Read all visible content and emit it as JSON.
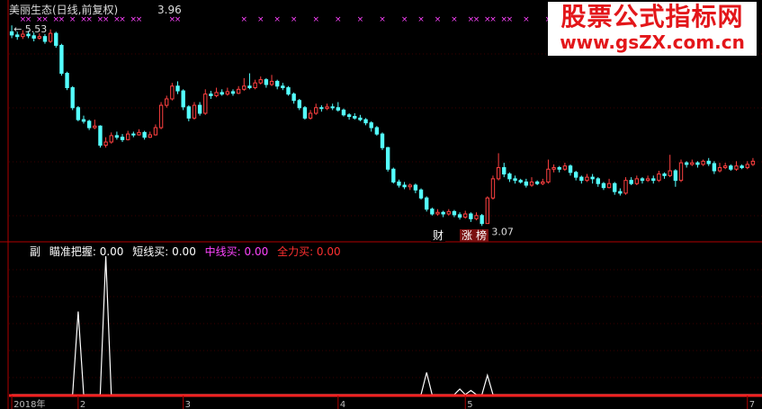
{
  "header": {
    "title": "美丽生态(日线,前复权)",
    "price": "3.96"
  },
  "indicator_header": {
    "prefix": "副",
    "items": [
      {
        "label": "瞄准把握: 0.00",
        "color": "#ffffff"
      },
      {
        "label": "短线买: 0.00",
        "color": "#ffffff"
      },
      {
        "label": "中线买: 0.00",
        "color": "#ff44ff"
      },
      {
        "label": "全力买: 0.00",
        "color": "#ff3030"
      }
    ]
  },
  "watermark": {
    "title": "股票公式指标网",
    "url": "www.gsZX.com.cn"
  },
  "badges": {
    "cai": "财",
    "zhangting": "涨",
    "bang": "榜"
  },
  "colors": {
    "up": "#ff4040",
    "down": "#54ffff",
    "axis": "#b00000",
    "magenta": "#ff44ff",
    "baseline": "#ff2020"
  },
  "chart_data": [
    {
      "type": "candlestick",
      "title": "美丽生态(日线,前复权)",
      "annotations": [
        {
          "text": "5.53",
          "kind": "high-marker"
        },
        {
          "text": "3.07",
          "kind": "low-marker"
        }
      ],
      "ylim": [
        2.95,
        5.65
      ],
      "candles": [
        [
          5.5,
          5.46,
          5.58,
          5.42
        ],
        [
          5.46,
          5.44,
          5.5,
          5.4
        ],
        [
          5.44,
          5.47,
          5.52,
          5.41
        ],
        [
          5.47,
          5.45,
          5.51,
          5.42
        ],
        [
          5.45,
          5.42,
          5.49,
          5.38
        ],
        [
          5.42,
          5.44,
          5.48,
          5.4
        ],
        [
          5.44,
          5.38,
          5.47,
          5.35
        ],
        [
          5.38,
          5.48,
          5.53,
          5.36
        ],
        [
          5.48,
          5.33,
          5.5,
          5.3
        ],
        [
          5.33,
          4.98,
          5.35,
          4.95
        ],
        [
          4.98,
          4.8,
          5.0,
          4.77
        ],
        [
          4.8,
          4.55,
          4.82,
          4.52
        ],
        [
          4.55,
          4.4,
          4.57,
          4.38
        ],
        [
          4.4,
          4.38,
          4.45,
          4.35
        ],
        [
          4.38,
          4.3,
          4.4,
          4.27
        ],
        [
          4.3,
          4.32,
          4.4,
          4.28
        ],
        [
          4.32,
          4.08,
          4.33,
          4.05
        ],
        [
          4.08,
          4.12,
          4.18,
          4.05
        ],
        [
          4.12,
          4.2,
          4.24,
          4.1
        ],
        [
          4.2,
          4.18,
          4.25,
          4.15
        ],
        [
          4.18,
          4.15,
          4.22,
          4.12
        ],
        [
          4.15,
          4.22,
          4.26,
          4.14
        ],
        [
          4.22,
          4.21,
          4.25,
          4.18
        ],
        [
          4.21,
          4.24,
          4.28,
          4.2
        ],
        [
          4.24,
          4.18,
          4.26,
          4.15
        ],
        [
          4.18,
          4.21,
          4.25,
          4.17
        ],
        [
          4.21,
          4.3,
          4.34,
          4.2
        ],
        [
          4.3,
          4.58,
          4.62,
          4.28
        ],
        [
          4.58,
          4.66,
          4.7,
          4.55
        ],
        [
          4.66,
          4.82,
          4.86,
          4.64
        ],
        [
          4.82,
          4.76,
          4.88,
          4.72
        ],
        [
          4.76,
          4.56,
          4.78,
          4.52
        ],
        [
          4.56,
          4.42,
          4.58,
          4.38
        ],
        [
          4.42,
          4.58,
          4.62,
          4.4
        ],
        [
          4.58,
          4.48,
          4.62,
          4.45
        ],
        [
          4.48,
          4.72,
          4.78,
          4.46
        ],
        [
          4.72,
          4.7,
          4.76,
          4.66
        ],
        [
          4.7,
          4.74,
          4.8,
          4.68
        ],
        [
          4.74,
          4.72,
          4.78,
          4.7
        ],
        [
          4.72,
          4.75,
          4.8,
          4.7
        ],
        [
          4.75,
          4.73,
          4.78,
          4.7
        ],
        [
          4.73,
          4.78,
          4.82,
          4.72
        ],
        [
          4.78,
          4.82,
          4.92,
          4.76
        ],
        [
          4.82,
          4.8,
          4.98,
          4.78
        ],
        [
          4.8,
          4.86,
          4.9,
          4.78
        ],
        [
          4.86,
          4.9,
          4.94,
          4.84
        ],
        [
          4.9,
          4.84,
          4.92,
          4.8
        ],
        [
          4.84,
          4.88,
          4.96,
          4.82
        ],
        [
          4.88,
          4.82,
          4.9,
          4.78
        ],
        [
          4.82,
          4.8,
          4.86,
          4.77
        ],
        [
          4.8,
          4.72,
          4.82,
          4.7
        ],
        [
          4.72,
          4.64,
          4.74,
          4.6
        ],
        [
          4.64,
          4.55,
          4.66,
          4.52
        ],
        [
          4.55,
          4.42,
          4.57,
          4.4
        ],
        [
          4.42,
          4.48,
          4.52,
          4.4
        ],
        [
          4.48,
          4.55,
          4.6,
          4.46
        ],
        [
          4.55,
          4.54,
          4.58,
          4.5
        ],
        [
          4.54,
          4.56,
          4.6,
          4.52
        ],
        [
          4.56,
          4.55,
          4.6,
          4.52
        ],
        [
          4.55,
          4.52,
          4.62,
          4.5
        ],
        [
          4.52,
          4.46,
          4.54,
          4.44
        ],
        [
          4.46,
          4.44,
          4.48,
          4.4
        ],
        [
          4.44,
          4.42,
          4.48,
          4.4
        ],
        [
          4.42,
          4.4,
          4.46,
          4.38
        ],
        [
          4.4,
          4.36,
          4.42,
          4.33
        ],
        [
          4.36,
          4.3,
          4.38,
          4.25
        ],
        [
          4.3,
          4.22,
          4.32,
          4.2
        ],
        [
          4.22,
          4.05,
          4.24,
          4.02
        ],
        [
          4.05,
          3.78,
          4.06,
          3.75
        ],
        [
          3.78,
          3.62,
          3.8,
          3.6
        ],
        [
          3.62,
          3.58,
          3.65,
          3.55
        ],
        [
          3.58,
          3.56,
          3.62,
          3.53
        ],
        [
          3.56,
          3.58,
          3.6,
          3.52
        ],
        [
          3.58,
          3.52,
          3.6,
          3.48
        ],
        [
          3.52,
          3.42,
          3.54,
          3.4
        ],
        [
          3.42,
          3.28,
          3.44,
          3.25
        ],
        [
          3.28,
          3.22,
          3.3,
          3.2
        ],
        [
          3.22,
          3.24,
          3.28,
          3.2
        ],
        [
          3.24,
          3.22,
          3.26,
          3.18
        ],
        [
          3.22,
          3.25,
          3.28,
          3.2
        ],
        [
          3.25,
          3.21,
          3.27,
          3.18
        ],
        [
          3.21,
          3.18,
          3.24,
          3.15
        ],
        [
          3.18,
          3.22,
          3.26,
          3.16
        ],
        [
          3.22,
          3.16,
          3.24,
          3.12
        ],
        [
          3.16,
          3.2,
          3.24,
          3.14
        ],
        [
          3.2,
          3.1,
          3.22,
          3.07
        ],
        [
          3.1,
          3.42,
          3.44,
          3.1
        ],
        [
          3.42,
          3.66,
          3.7,
          3.4
        ],
        [
          3.66,
          3.8,
          3.98,
          3.64
        ],
        [
          3.8,
          3.72,
          3.86,
          3.68
        ],
        [
          3.72,
          3.66,
          3.74,
          3.62
        ],
        [
          3.66,
          3.64,
          3.7,
          3.6
        ],
        [
          3.64,
          3.62,
          3.66,
          3.6
        ],
        [
          3.62,
          3.58,
          3.66,
          3.55
        ],
        [
          3.58,
          3.62,
          3.68,
          3.56
        ],
        [
          3.62,
          3.6,
          3.64,
          3.58
        ],
        [
          3.6,
          3.62,
          3.66,
          3.58
        ],
        [
          3.62,
          3.78,
          3.9,
          3.6
        ],
        [
          3.78,
          3.8,
          3.84,
          3.74
        ],
        [
          3.8,
          3.78,
          3.82,
          3.74
        ],
        [
          3.78,
          3.82,
          3.86,
          3.76
        ],
        [
          3.82,
          3.74,
          3.84,
          3.7
        ],
        [
          3.74,
          3.68,
          3.76,
          3.64
        ],
        [
          3.68,
          3.64,
          3.7,
          3.6
        ],
        [
          3.64,
          3.68,
          3.72,
          3.62
        ],
        [
          3.68,
          3.66,
          3.72,
          3.6
        ],
        [
          3.66,
          3.6,
          3.68,
          3.56
        ],
        [
          3.6,
          3.55,
          3.62,
          3.52
        ],
        [
          3.55,
          3.6,
          3.66,
          3.54
        ],
        [
          3.6,
          3.5,
          3.62,
          3.46
        ],
        [
          3.5,
          3.48,
          3.54,
          3.45
        ],
        [
          3.48,
          3.64,
          3.68,
          3.46
        ],
        [
          3.64,
          3.6,
          3.68,
          3.58
        ],
        [
          3.6,
          3.66,
          3.7,
          3.58
        ],
        [
          3.66,
          3.64,
          3.68,
          3.6
        ],
        [
          3.64,
          3.66,
          3.7,
          3.62
        ],
        [
          3.66,
          3.64,
          3.7,
          3.6
        ],
        [
          3.64,
          3.72,
          3.76,
          3.62
        ],
        [
          3.72,
          3.7,
          3.74,
          3.66
        ],
        [
          3.7,
          3.76,
          3.96,
          3.68
        ],
        [
          3.76,
          3.64,
          3.78,
          3.56
        ],
        [
          3.64,
          3.86,
          3.9,
          3.62
        ],
        [
          3.86,
          3.84,
          3.88,
          3.8
        ],
        [
          3.84,
          3.86,
          3.9,
          3.82
        ],
        [
          3.86,
          3.84,
          3.88,
          3.8
        ],
        [
          3.84,
          3.88,
          3.9,
          3.82
        ],
        [
          3.88,
          3.85,
          3.92,
          3.82
        ],
        [
          3.85,
          3.76,
          3.88,
          3.72
        ],
        [
          3.76,
          3.8,
          3.86,
          3.74
        ],
        [
          3.8,
          3.82,
          3.86,
          3.78
        ],
        [
          3.82,
          3.78,
          3.84,
          3.76
        ],
        [
          3.78,
          3.82,
          3.88,
          3.76
        ],
        [
          3.82,
          3.8,
          3.84,
          3.78
        ],
        [
          3.8,
          3.84,
          3.88,
          3.78
        ],
        [
          3.84,
          3.88,
          3.92,
          3.82
        ]
      ]
    },
    {
      "type": "line",
      "title": "瞄准把握",
      "values": [
        0,
        0,
        0,
        0,
        0,
        0,
        0,
        0,
        0,
        0,
        0,
        0,
        0,
        0,
        0,
        0,
        0,
        0,
        0,
        0,
        0,
        0,
        0,
        0,
        0,
        0,
        0,
        0,
        0,
        0,
        0,
        0,
        0,
        0,
        0,
        0,
        0,
        0,
        0,
        0,
        0,
        0,
        0,
        0,
        0,
        0,
        0,
        0,
        0,
        0,
        0,
        0,
        0,
        0,
        0,
        0,
        0,
        0,
        0,
        0,
        0,
        0,
        0,
        0,
        0,
        0,
        0,
        0,
        0,
        0,
        0,
        0,
        0,
        0,
        0,
        0,
        0,
        0,
        0,
        0,
        0,
        0,
        0,
        0,
        0,
        0,
        0,
        0,
        0,
        0,
        0,
        0,
        0,
        0,
        0,
        0,
        0,
        0,
        0,
        0,
        0,
        0,
        0,
        0,
        0,
        0,
        0,
        0,
        0,
        0,
        0,
        0,
        0,
        0,
        0,
        0,
        0,
        0,
        0,
        0,
        0,
        0,
        0,
        0,
        0,
        0,
        0,
        0,
        0,
        0,
        0,
        0,
        0,
        0,
        0,
        0,
        0,
        0,
        0,
        0,
        0,
        0,
        0,
        0,
        0
      ],
      "spikes": [
        {
          "index": 12,
          "value": 0.6
        },
        {
          "index": 17,
          "value": 1.0
        },
        {
          "index": 75,
          "value": 0.16
        },
        {
          "index": 81,
          "value": 0.04
        },
        {
          "index": 83,
          "value": 0.03
        },
        {
          "index": 86,
          "value": 0.14
        }
      ],
      "baseline": 0,
      "x_ticks": [
        {
          "label": "2018年",
          "index": 0
        },
        {
          "label": "2",
          "index": 12
        },
        {
          "label": "3",
          "index": 31
        },
        {
          "label": "4",
          "index": 59
        },
        {
          "label": "5",
          "index": 82
        },
        {
          "label": "7",
          "index": 133
        }
      ]
    }
  ],
  "markers": {
    "magenta_x_positions": [
      2,
      3,
      5,
      6,
      8,
      9,
      11,
      13,
      14,
      16,
      17,
      19,
      20,
      22,
      23,
      29,
      30,
      42,
      45,
      48,
      51,
      55,
      59,
      63,
      67,
      71,
      74,
      77,
      80,
      83,
      84,
      86,
      87,
      89,
      90,
      93,
      97,
      101
    ]
  }
}
